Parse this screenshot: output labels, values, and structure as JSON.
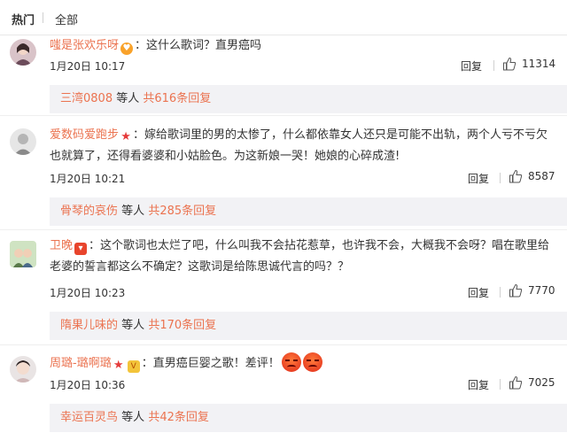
{
  "tabs": {
    "active": "热门",
    "inactive": "全部"
  },
  "comments": [
    {
      "user": "嗤是张欢乐呀",
      "badges": [
        "heart"
      ],
      "text": "：这什么歌词？直男癌吗",
      "time": "1月20日 10:17",
      "reply_label": "回复",
      "likes": "11314",
      "reply_user": "三湾0808",
      "reply_mid": "等人",
      "reply_count": "共616条回复"
    },
    {
      "user": "爱数码爱跑步",
      "badges": [
        "star"
      ],
      "text": "：嫁给歌词里的男的太惨了，什么都依靠女人还只是可能不出轨，两个人亏不亏欠也就算了，还得看婆婆和小姑脸色。为这新娘一哭！她娘的心碎成渣!",
      "time": "1月20日 10:21",
      "reply_label": "回复",
      "likes": "8587",
      "reply_user": "骨琴的哀伤",
      "reply_mid": "等人",
      "reply_count": "共285条回复"
    },
    {
      "user": "卫晚",
      "badges": [
        "redgift"
      ],
      "text": "：这个歌词也太烂了吧，什么叫我不会拈花惹草，也许我不会，大概我不会呀？唱在歌里给老婆的誓言都这么不确定？这歌词是给陈思诚代言的吗？？",
      "time": "1月20日 10:23",
      "reply_label": "回复",
      "likes": "7770",
      "reply_user": "隋果儿味的",
      "reply_mid": "等人",
      "reply_count": "共170条回复"
    },
    {
      "user": "周璐-璐啊璐",
      "badges": [
        "star",
        "vip"
      ],
      "text": "：直男癌巨婴之歌！差评！",
      "time": "1月20日 10:36",
      "reply_label": "回复",
      "likes": "7025",
      "reply_user": "幸运百灵鸟",
      "reply_mid": "等人",
      "reply_count": "共42条回复"
    }
  ],
  "icons": {
    "like": "thumbs-up-icon",
    "heart_badge": "heart-badge-icon",
    "star_badge": "star-badge-icon",
    "gift_badge": "red-gift-badge-icon",
    "vip_badge": "vip-badge-icon",
    "angry_emoji": "angry-face-emoji"
  },
  "colors": {
    "username": "#eb7350",
    "reply_bg": "#f2f2f5"
  }
}
